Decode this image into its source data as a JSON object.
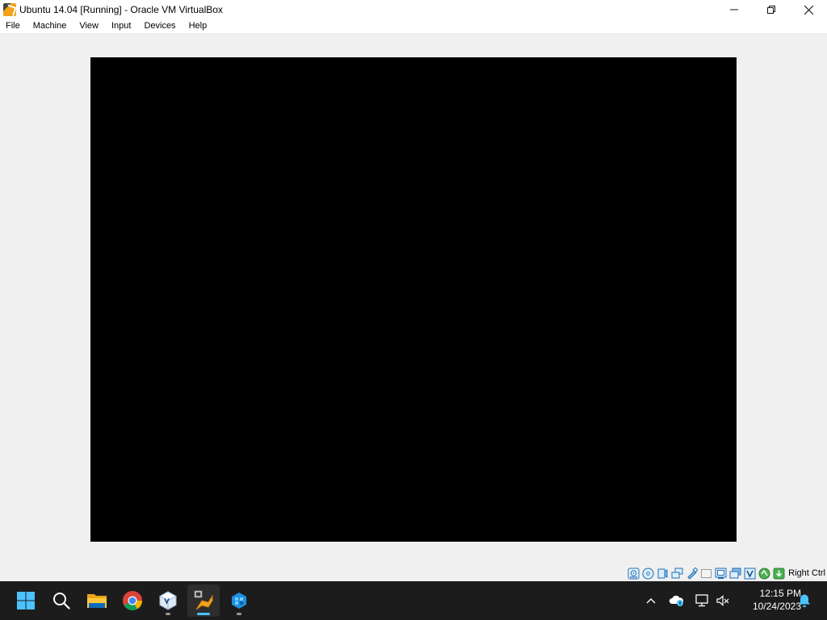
{
  "window": {
    "title": "Ubuntu 14.04 [Running] - Oracle VM VirtualBox",
    "app_icon": "virtualbox-vm-icon",
    "controls": {
      "minimize": "—",
      "maximize": "❐",
      "close": "✕"
    }
  },
  "menubar": {
    "items": [
      {
        "label": "File"
      },
      {
        "label": "Machine"
      },
      {
        "label": "View"
      },
      {
        "label": "Input"
      },
      {
        "label": "Devices"
      },
      {
        "label": "Help"
      }
    ]
  },
  "vm_display": {
    "background": "#000000"
  },
  "statusbar": {
    "icons": [
      "hard-disk-icon",
      "optical-drive-icon",
      "audio-icon",
      "network-icon",
      "usb-icon",
      "shared-folders-icon",
      "display-icon",
      "video-capture-icon",
      "virtualization-icon",
      "mouse-integration-icon",
      "keyboard-capture-icon"
    ],
    "host_key": "Right Ctrl"
  },
  "taskbar": {
    "apps": [
      {
        "name": "start",
        "icon": "windows-start-icon"
      },
      {
        "name": "search",
        "icon": "search-icon"
      },
      {
        "name": "file-explorer",
        "icon": "folder-icon"
      },
      {
        "name": "chrome",
        "icon": "chrome-icon"
      },
      {
        "name": "virtualbox-manager",
        "icon": "virtualbox-icon"
      },
      {
        "name": "virtualbox-vm",
        "icon": "virtualbox-vm-icon"
      },
      {
        "name": "app-blue",
        "icon": "blue-app-icon"
      }
    ],
    "tray": {
      "chevron": "^",
      "clock_time": "12:15 PM",
      "clock_date": "10/24/2023"
    }
  },
  "colors": {
    "taskbar_bg": "#1c1c1c",
    "active_indicator": "#4cc2ff",
    "window_bg": "#f0f0f0"
  }
}
